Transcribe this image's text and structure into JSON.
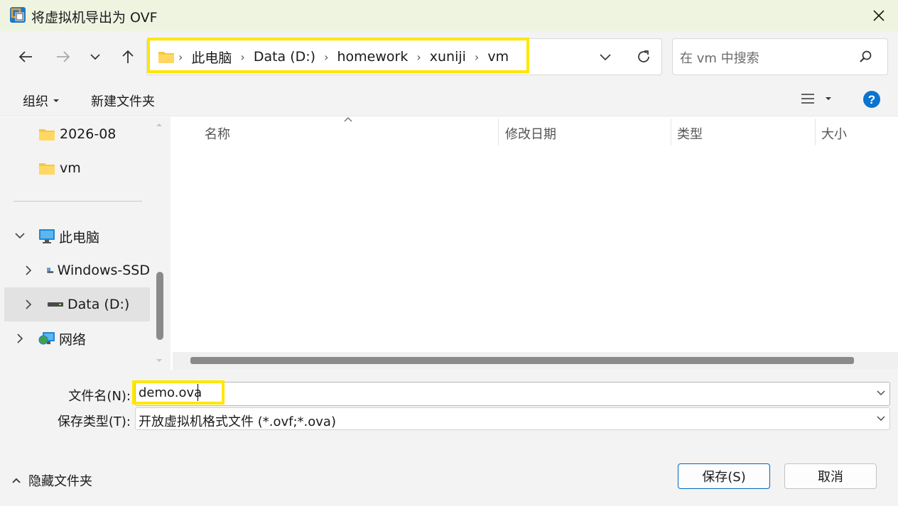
{
  "window": {
    "title": "将虚拟机导出为 OVF"
  },
  "nav": {
    "breadcrumbs": [
      "此电脑",
      "Data (D:)",
      "homework",
      "xuniji",
      "vm"
    ],
    "search_placeholder": "在 vm 中搜索"
  },
  "toolbar": {
    "organize_label": "组织",
    "new_folder_label": "新建文件夹"
  },
  "sidebar": {
    "folders": [
      {
        "label": "2026-08",
        "icon": "folder-icon"
      },
      {
        "label": "vm",
        "icon": "folder-icon"
      }
    ],
    "this_pc": {
      "label": "此电脑",
      "icon": "monitor-icon"
    },
    "drives": [
      {
        "label": "Windows-SSD",
        "icon": "windows-drive-icon"
      },
      {
        "label": "Data (D:)",
        "icon": "drive-icon",
        "selected": true
      }
    ],
    "network": {
      "label": "网络",
      "icon": "network-icon"
    }
  },
  "filelist": {
    "columns": [
      "名称",
      "修改日期",
      "类型",
      "大小"
    ],
    "rows": []
  },
  "form": {
    "filename_label": "文件名(N):",
    "filename_value": "demo.ova",
    "filetype_label": "保存类型(T):",
    "filetype_value": "开放虚拟机格式文件 (*.ovf;*.ova)"
  },
  "footer": {
    "hide_folders_label": "隐藏文件夹",
    "save_label": "保存(S)",
    "cancel_label": "取消"
  },
  "colors": {
    "highlight": "#ffe600",
    "accent": "#0067c0",
    "titlebar": "#eff4e1"
  }
}
